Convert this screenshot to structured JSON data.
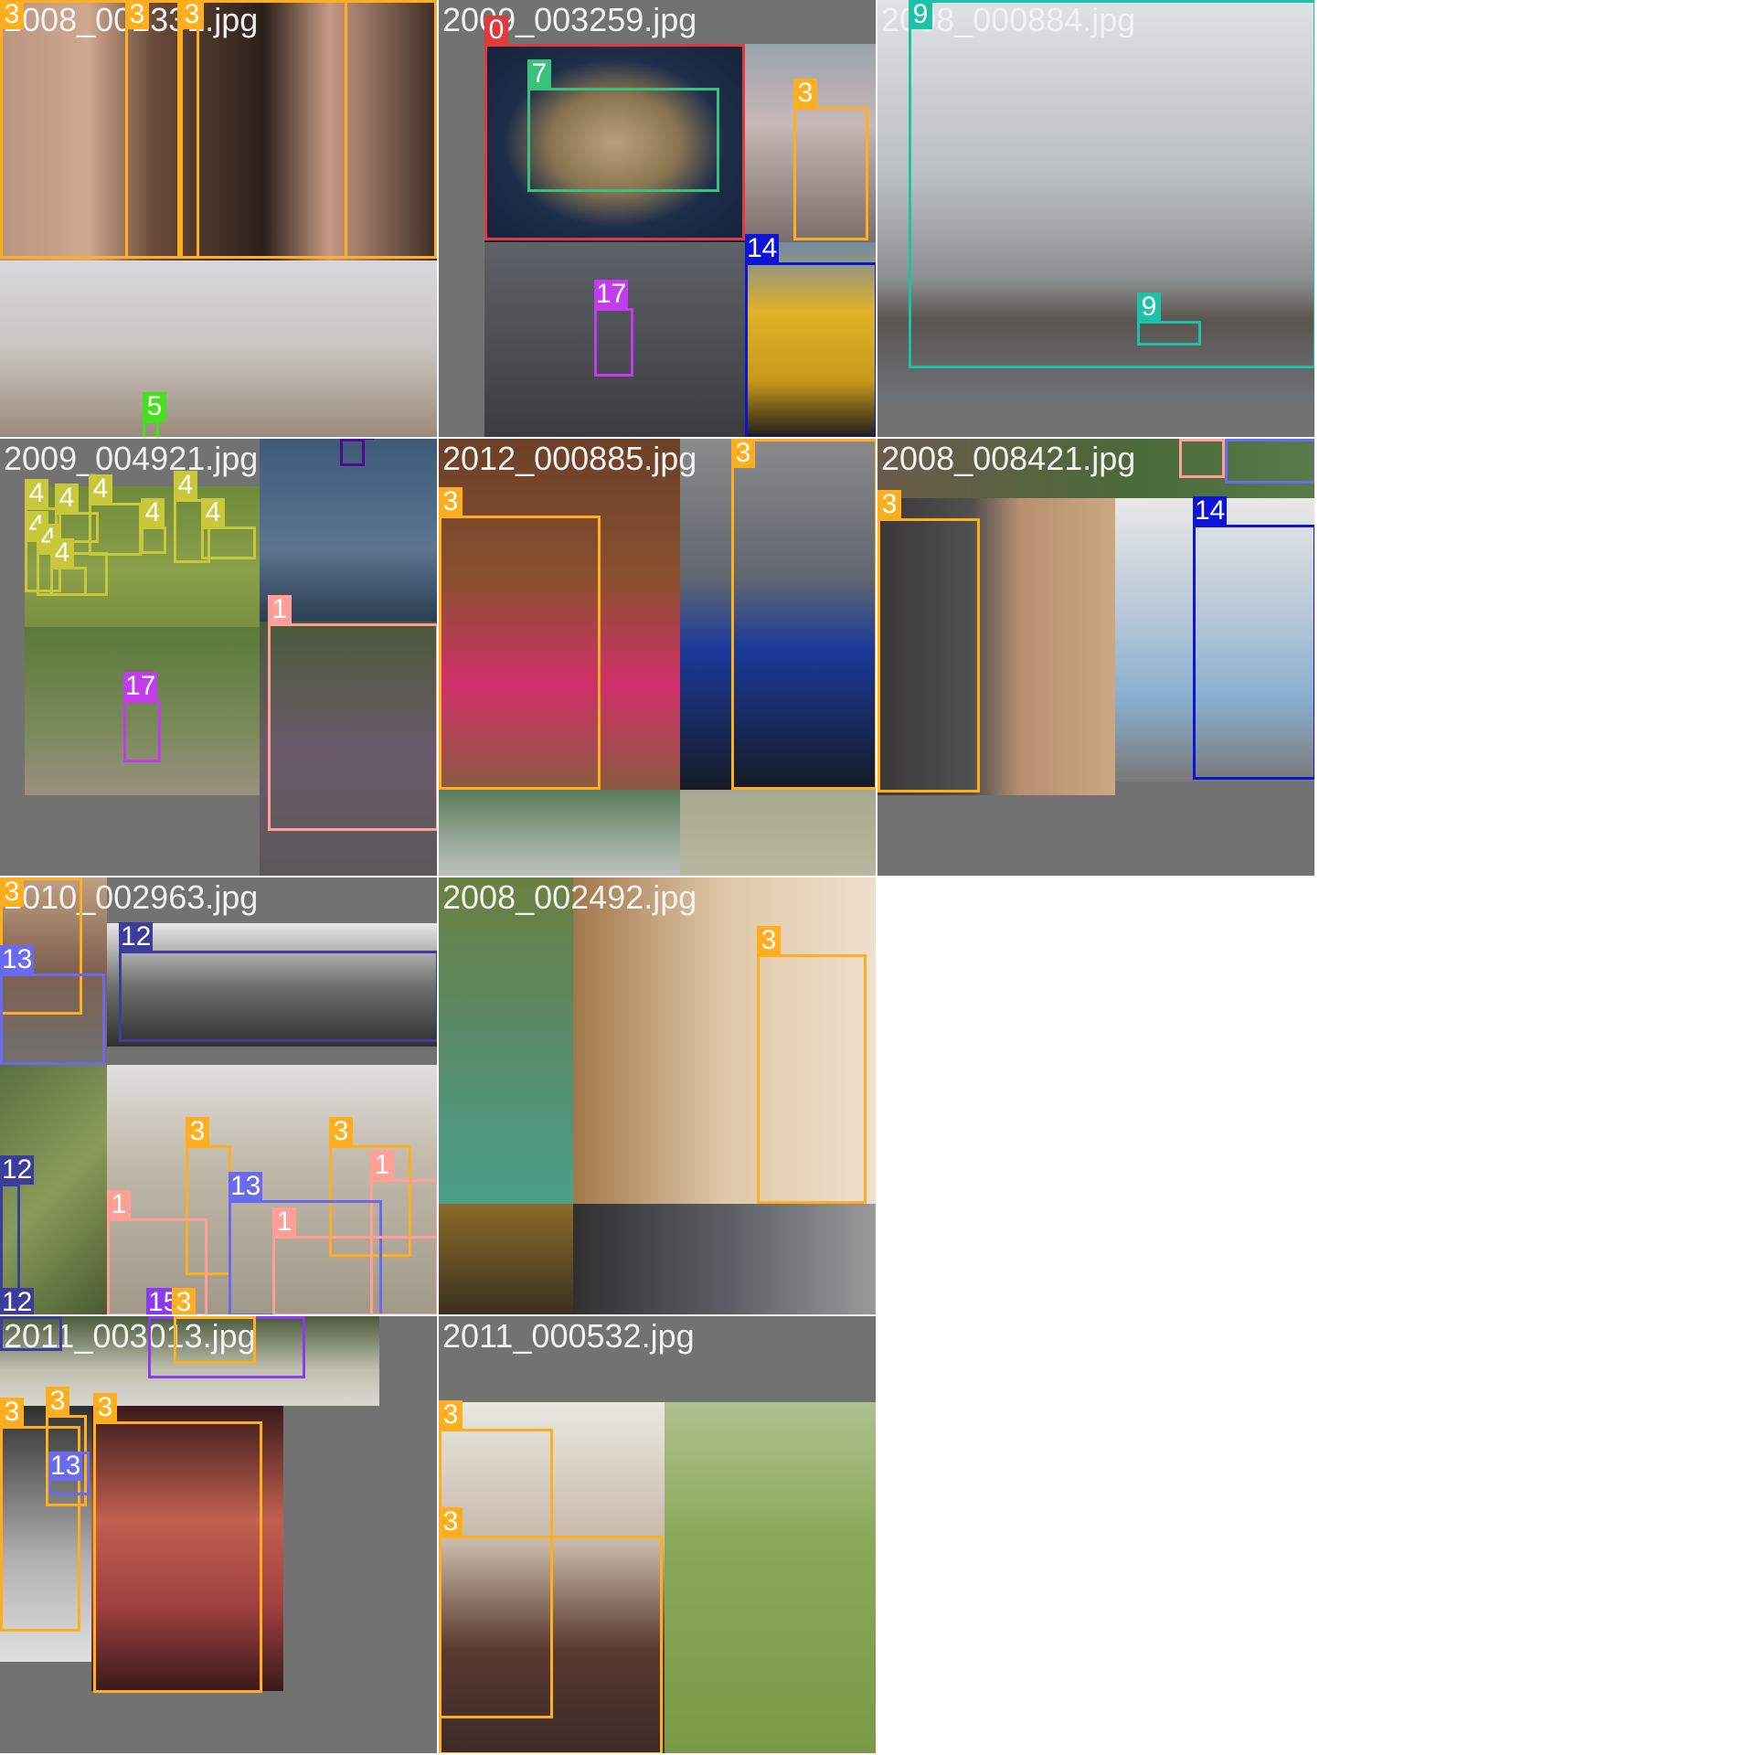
{
  "colors": {
    "0": "#e03a3a",
    "1": "#ff9f96",
    "3": "#ffae1f",
    "4": "#c8c83a",
    "5": "#47e01f",
    "7": "#3ac27a",
    "9": "#1cc2a8",
    "12": "#3a3d9c",
    "13": "#6a6aef",
    "14": "#0d14d9",
    "15": "#8b3aef",
    "16": "#4b0d8f",
    "17": "#c43aef"
  },
  "tiles": [
    {
      "filename": "2008_002331.jpg",
      "labels": [
        "3",
        "3",
        "3",
        "5"
      ]
    },
    {
      "filename": "2009_003259.jpg",
      "labels": [
        "0",
        "7",
        "3",
        "14",
        "17"
      ]
    },
    {
      "filename": "2008_000884.jpg",
      "labels": [
        "9",
        "9"
      ]
    },
    {
      "filename": "2009_004921.jpg",
      "labels": [
        "4",
        "4",
        "4",
        "4",
        "4",
        "4",
        "4",
        "4",
        "4",
        "17",
        "1",
        "16"
      ]
    },
    {
      "filename": "2012_000885.jpg",
      "labels": [
        "3",
        "3"
      ]
    },
    {
      "filename": "2008_008421.jpg",
      "labels": [
        "3",
        "14",
        "1",
        "13"
      ]
    },
    {
      "filename": "2010_002963.jpg",
      "labels": [
        "3",
        "13",
        "12",
        "12",
        "3",
        "3",
        "1",
        "1",
        "13",
        "1",
        "12",
        "15",
        "3"
      ]
    },
    {
      "filename": "2008_002492.jpg",
      "labels": [
        "3"
      ]
    },
    {
      "filename": "2011_003013.jpg",
      "labels": [
        "3",
        "3",
        "3",
        "13"
      ]
    },
    {
      "filename": "2011_000532.jpg",
      "labels": [
        "3",
        "3"
      ]
    }
  ]
}
